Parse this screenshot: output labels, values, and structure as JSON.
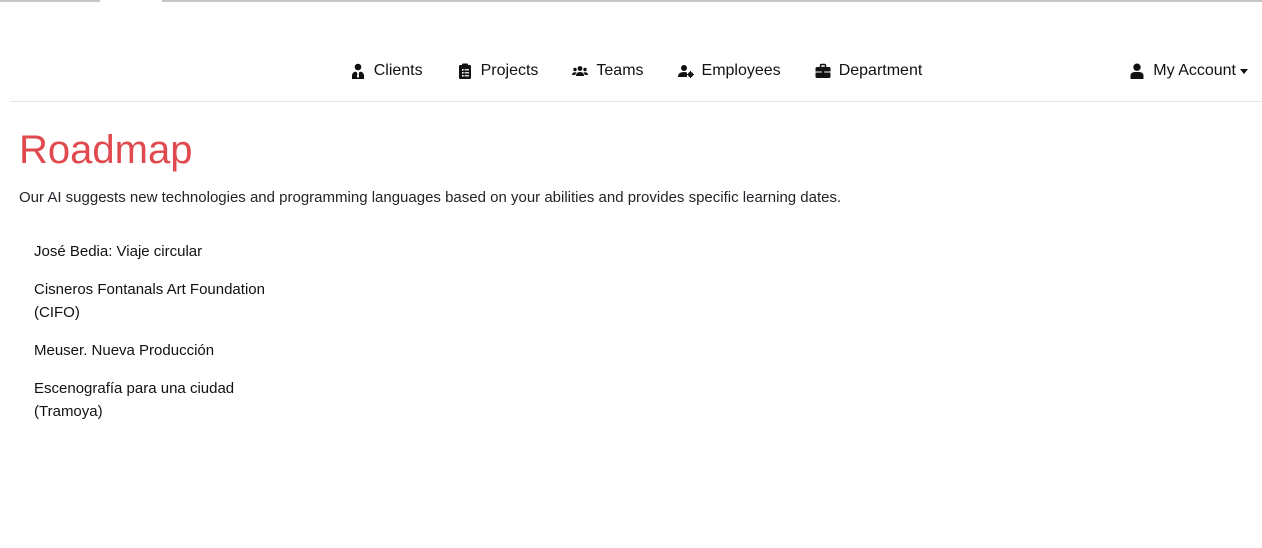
{
  "nav": {
    "links": [
      {
        "label": "Clients",
        "icon": "user-tie-icon"
      },
      {
        "label": "Projects",
        "icon": "clipboard-list-icon"
      },
      {
        "label": "Teams",
        "icon": "users-icon"
      },
      {
        "label": "Employees",
        "icon": "user-cog-icon"
      },
      {
        "label": "Department",
        "icon": "briefcase-icon"
      }
    ],
    "account": {
      "label": "My Account",
      "icon": "user-icon"
    }
  },
  "main": {
    "title": "Roadmap",
    "description": "Our AI suggests new technologies and programming languages based on your abilities and provides specific learning dates.",
    "items": [
      {
        "line1": "José Bedia: Viaje circular",
        "line2": ""
      },
      {
        "line1": "Cisneros Fontanals Art Foundation",
        "line2": "(CIFO)"
      },
      {
        "line1": "Meuser. Nueva Producción",
        "line2": ""
      },
      {
        "line1": "Escenografía para una ciudad",
        "line2": "(Tramoya)"
      }
    ]
  },
  "colors": {
    "title": "#e04a4f",
    "text": "#212529"
  }
}
